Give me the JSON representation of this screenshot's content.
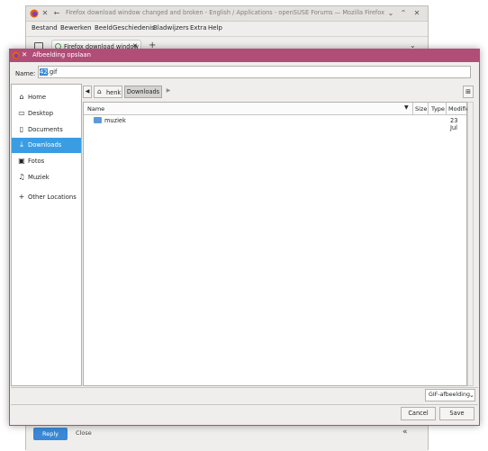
{
  "browser": {
    "window_title": "Firefox download window changed and broken - English / Applications - openSUSE Forums — Mozilla Firefox",
    "menu": [
      "Bestand",
      "Bewerken",
      "Beeld",
      "Geschiedenis",
      "Bladwijzers",
      "Extra",
      "Help"
    ],
    "tab_title": "Firefox download window",
    "new_tab": "+",
    "reply_label": "Reply",
    "close_label": "Close"
  },
  "dialog": {
    "title": "Afbeelding opslaan",
    "name_label": "Name:",
    "filename_selected": "42",
    "filename_rest": ".gif",
    "places": [
      {
        "label": "Home",
        "icon": "home-icon"
      },
      {
        "label": "Desktop",
        "icon": "desktop-icon"
      },
      {
        "label": "Documents",
        "icon": "documents-icon"
      },
      {
        "label": "Downloads",
        "icon": "downloads-icon",
        "active": true
      },
      {
        "label": "Fotos",
        "icon": "pictures-icon"
      },
      {
        "label": "Muziek",
        "icon": "music-icon"
      },
      {
        "label": "Other Locations",
        "icon": "add-icon"
      }
    ],
    "breadcrumb": {
      "home": "henk",
      "current": "Downloads"
    },
    "columns": {
      "name": "Name",
      "size": "Size",
      "type": "Type",
      "modified": "Modified"
    },
    "files": [
      {
        "name": "muziek",
        "size": "",
        "type": "",
        "modified": "23 Jul"
      }
    ],
    "filetype": "GIF-afbeelding",
    "cancel_label": "Cancel",
    "save_label": "Save"
  },
  "colors": {
    "accent": "#3a9de4",
    "dialog_border": "#b04e78"
  }
}
